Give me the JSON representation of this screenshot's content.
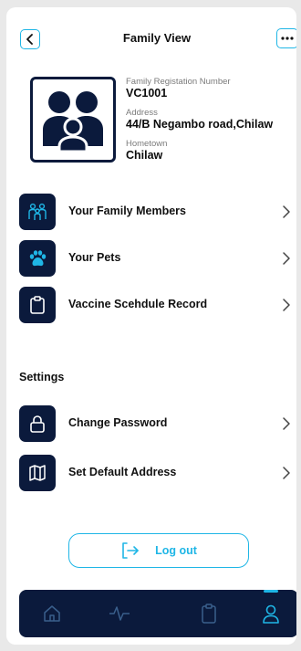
{
  "header": {
    "title": "Family View"
  },
  "profile": {
    "reg_label": "Family Registation Number",
    "reg_value": "VC1001",
    "address_label": "Address",
    "address_value": "44/B Negambo road,Chilaw",
    "hometown_label": "Hometown",
    "hometown_value": "Chilaw"
  },
  "menu": {
    "items": [
      {
        "label": "Your Family Members",
        "icon": "family-icon"
      },
      {
        "label": "Your Pets",
        "icon": "paw-icon"
      },
      {
        "label": "Vaccine Scehdule Record",
        "icon": "clipboard-icon"
      }
    ]
  },
  "settings": {
    "title": "Settings",
    "items": [
      {
        "label": "Change Password",
        "icon": "lock-icon"
      },
      {
        "label": "Set Default Address",
        "icon": "map-icon"
      }
    ]
  },
  "logout": {
    "label": "Log out"
  },
  "bottom_nav": {
    "items": [
      "home-icon",
      "activity-icon",
      "clipboard-icon",
      "user-icon"
    ],
    "active": "user-icon"
  },
  "colors": {
    "accent": "#1fb6e6",
    "navy": "#0b1a3c"
  }
}
